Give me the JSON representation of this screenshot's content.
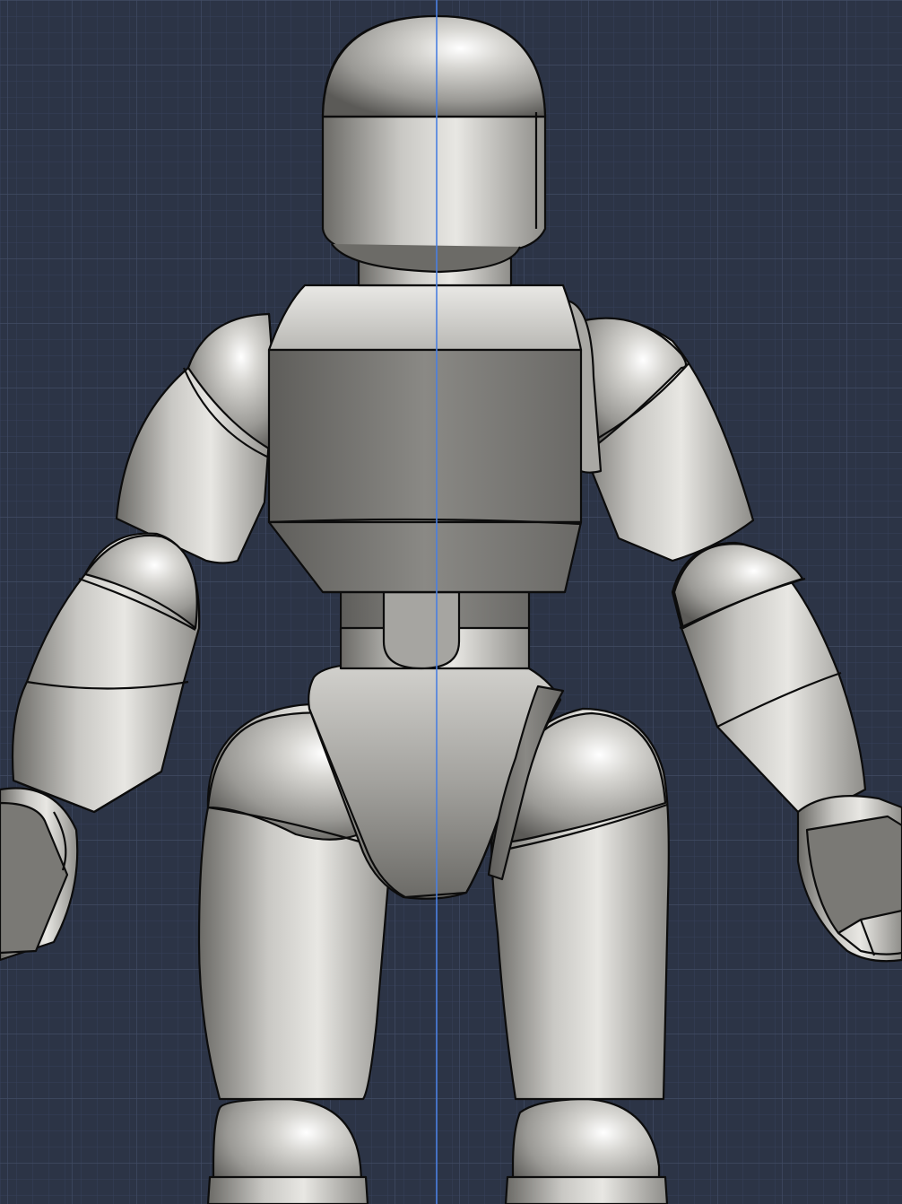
{
  "viewport": {
    "background_color": "#2c3446",
    "grid_minor_color": "#37405a",
    "grid_major_color": "#414b63",
    "center_line_color": "#4a7fe0"
  },
  "model": {
    "material_light": "#ecebe8",
    "material_mid": "#a9a8a4",
    "material_dark": "#5b5a57",
    "outline_color": "#0c0c0c",
    "parts": [
      "head",
      "neck",
      "torso",
      "waist",
      "hips",
      "upper-arm-left",
      "forearm-left",
      "hand-left",
      "upper-arm-right",
      "forearm-right",
      "hand-right",
      "thigh-left",
      "thigh-right",
      "knee-left",
      "knee-right"
    ]
  }
}
